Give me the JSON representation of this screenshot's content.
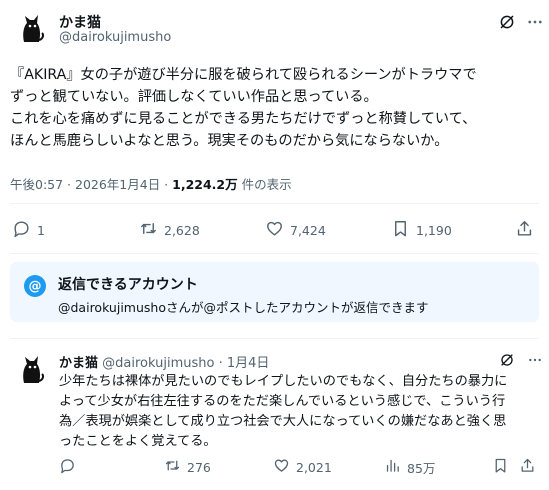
{
  "post": {
    "display_name": "かま猫",
    "handle": "@dairokujimusho",
    "lines": [
      "『AKIRA』女の子が遊び半分に服を破られて殴られるシーンがトラウマで",
      "ずっと観ていない。評価しなくていい作品と思っている。",
      "これを心を痛めずに見ることができる男たちだけでずっと称賛していて、",
      "ほんと馬鹿らしいよなと思う。現実そのものだから気にならないか。"
    ],
    "time": "午後0:57 · 2026年1月4日 · ",
    "views": "1,224.2万",
    "views_suffix": " 件の表示",
    "stats": {
      "replies": "1",
      "reposts": "2,628",
      "likes": "7,424",
      "bookmarks": "1,190"
    }
  },
  "reply_notice": {
    "icon": "@",
    "title": "返信できるアカウント",
    "text": "@dairokujimushoさんが@ポストしたアカウントが返信できます"
  },
  "reply": {
    "display_name": "かま猫",
    "handle": "@dairokujimusho",
    "date": "1月4日",
    "lines": [
      "少年たちは裸体が見たいのでもレイプしたいのでもなく、自分たちの暴力に",
      "よって少女が右往左往するのをただ楽しんでいるという感じで、こういう行",
      "為／表現が娯楽として成り立つ社会で大人になっていくの嫌だなあと強く思",
      "ったことをよく覚えてる。"
    ],
    "stats": {
      "replies": "",
      "reposts": "276",
      "likes": "2,021",
      "views": "85万"
    }
  },
  "icons": [
    "grok-icon",
    "more-icon",
    "reply-icon",
    "repost-icon",
    "like-icon",
    "bookmark-icon",
    "share-icon",
    "views-icon"
  ]
}
